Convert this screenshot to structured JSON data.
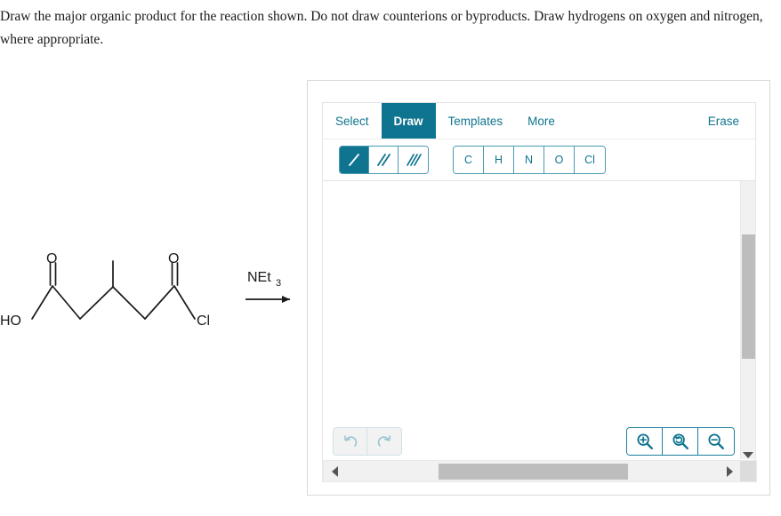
{
  "question": {
    "prompt": "Draw the major organic product for the reaction shown. Do not draw counterions or byproducts. Draw hydrogens on oxygen and nitrogen, where appropriate."
  },
  "reaction": {
    "reactant_labels": {
      "hydroxyl": "HO",
      "carbonyl_oxygen_left": "O",
      "carbonyl_oxygen_right": "O",
      "chloride": "Cl"
    },
    "reagent": {
      "text": "NEt",
      "subscript": "3"
    },
    "arrow": "reaction-arrow"
  },
  "sketcher": {
    "tabs": [
      {
        "label": "Select",
        "active": false
      },
      {
        "label": "Draw",
        "active": true
      },
      {
        "label": "Templates",
        "active": false
      },
      {
        "label": "More",
        "active": false
      }
    ],
    "erase_label": "Erase",
    "bond_tools": [
      {
        "name": "single-bond-tool",
        "icon": "single-bond-icon",
        "selected": true
      },
      {
        "name": "double-bond-tool",
        "icon": "double-bond-icon",
        "selected": false
      },
      {
        "name": "triple-bond-tool",
        "icon": "triple-bond-icon",
        "selected": false
      }
    ],
    "element_tools": [
      {
        "label": "C",
        "name": "element-button-carbon"
      },
      {
        "label": "H",
        "name": "element-button-hydrogen"
      },
      {
        "label": "N",
        "name": "element-button-nitrogen"
      },
      {
        "label": "O",
        "name": "element-button-oxygen"
      },
      {
        "label": "Cl",
        "name": "element-button-chlorine"
      }
    ],
    "history_tools": [
      {
        "name": "undo-button",
        "icon": "undo-icon",
        "enabled": false
      },
      {
        "name": "redo-button",
        "icon": "redo-icon",
        "enabled": false
      }
    ],
    "zoom_tools": [
      {
        "name": "zoom-in-button",
        "icon": "zoom-in-icon"
      },
      {
        "name": "zoom-reset-button",
        "icon": "zoom-reset-icon"
      },
      {
        "name": "zoom-out-button",
        "icon": "zoom-out-icon"
      }
    ]
  },
  "colors": {
    "accent": "#0e7490",
    "accent_text": "#11748f",
    "border": "#e3e3e3",
    "panel_border": "#d8d8d8",
    "scrollbar_track": "#f1f1f1",
    "scrollbar_thumb": "#bdbdbd",
    "disabled_icon": "#9ec6d3",
    "structure_line": "#1a1a1a"
  }
}
